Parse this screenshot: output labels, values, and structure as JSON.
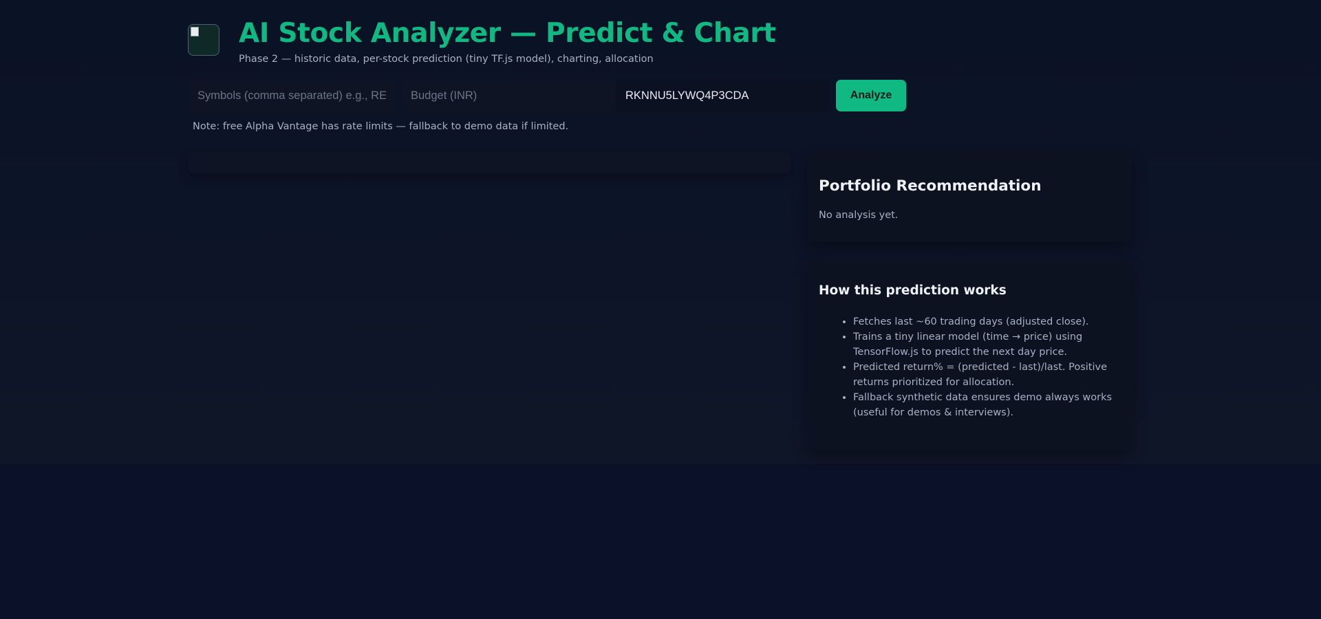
{
  "header": {
    "title": "AI Stock Analyzer — Predict & Chart",
    "subtitle": "Phase 2 — historic data, per-stock prediction (tiny TF.js model), charting, allocation"
  },
  "controls": {
    "symbols_placeholder": "Symbols (comma separated) e.g., RE",
    "budget_placeholder": "Budget (INR)",
    "api_key_value": "RKNNU5LYWQ4P3CDA",
    "analyze_label": "Analyze"
  },
  "note": "Note: free Alpha Vantage has rate limits — fallback to demo data if limited.",
  "portfolio": {
    "title": "Portfolio Recommendation",
    "status": "No analysis yet."
  },
  "how_it_works": {
    "title": "How this prediction works",
    "items": [
      "Fetches last ~60 trading days (adjusted close).",
      "Trains a tiny linear model (time → price) using TensorFlow.js to predict the next day price.",
      "Predicted return% = (predicted - last)/last. Positive returns prioritized for allocation.",
      "Fallback synthetic data ensures demo always works (useful for demos & interviews)."
    ]
  },
  "colors": {
    "accent": "#10b981",
    "background": "#0a1128",
    "card": "#0c1220",
    "muted_text": "#a7b1c2"
  }
}
